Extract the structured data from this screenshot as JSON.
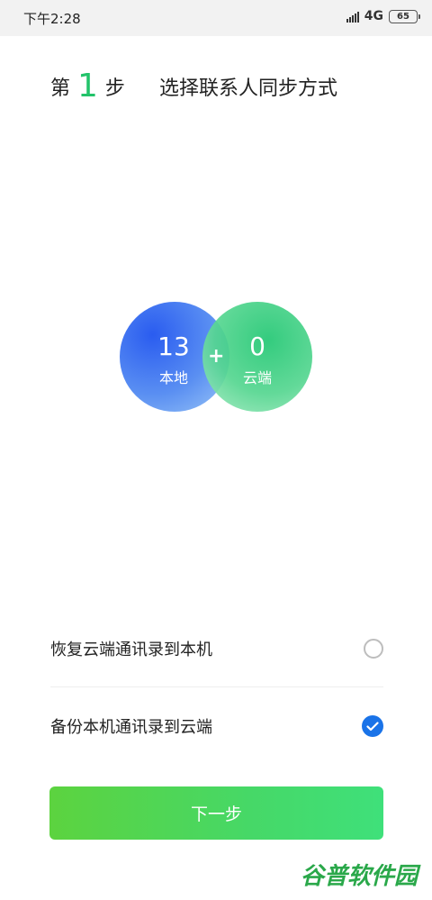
{
  "status_bar": {
    "time": "下午2:28",
    "network": "4G",
    "battery": "65",
    "icons": [
      "signal-icon",
      "battery-icon"
    ]
  },
  "header": {
    "step_prefix": "第",
    "step_number": "1",
    "step_suffix": "步",
    "title": "选择联系人同步方式"
  },
  "circles": {
    "local_count": "13",
    "local_label": "本地",
    "cloud_count": "0",
    "cloud_label": "云端",
    "plus": "+",
    "colors": {
      "local": "#2a5cf0",
      "cloud": "#22c773"
    }
  },
  "options": [
    {
      "label": "恢复云端通讯录到本机",
      "selected": false
    },
    {
      "label": "备份本机通讯录到云端",
      "selected": true
    }
  ],
  "next_button_label": "下一步",
  "watermark": "谷普软件园",
  "accent_colors": {
    "step_number": "#22c36a",
    "radio_checked": "#1a73e8",
    "button_start": "#5cd33f",
    "button_end": "#3fe07a"
  }
}
